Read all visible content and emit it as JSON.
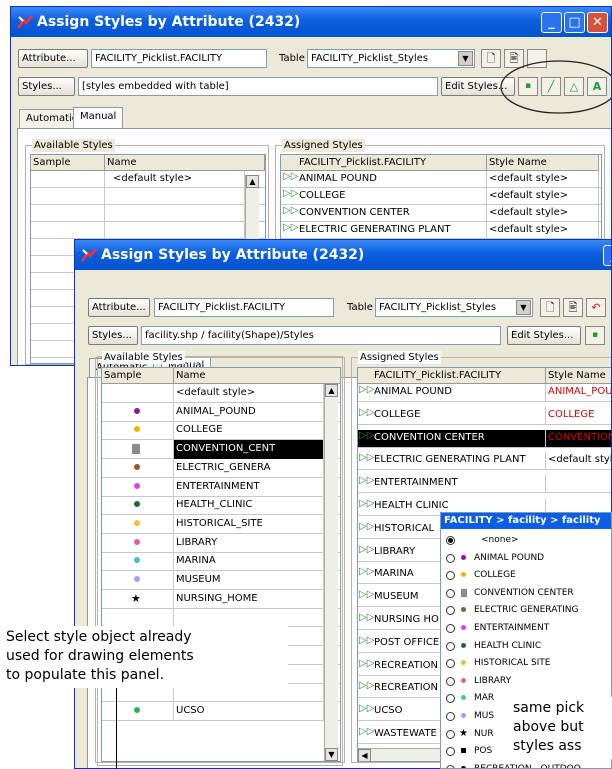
{
  "back_window": {
    "title": "Assign Styles by Attribute (2432)",
    "attribute_button": "Attribute...",
    "attribute_value": "FACILITY_Picklist.FACILITY",
    "table_label": "Table",
    "table_value": "FACILITY_Picklist_Styles",
    "styles_button": "Styles...",
    "styles_value": "[styles embedded with table]",
    "edit_styles_button": "Edit Styles...",
    "tabs": [
      "Automatic",
      "Manual"
    ],
    "available_legend": "Available Styles",
    "available_headers": [
      "Sample",
      "Name"
    ],
    "available_rows": [
      "<default style>"
    ],
    "assigned_legend": "Assigned Styles",
    "assigned_headers": [
      "FACILITY_Picklist.FACILITY",
      "Style Name"
    ],
    "assigned_rows": [
      {
        "facility": "ANIMAL POUND",
        "style": "<default style>"
      },
      {
        "facility": "COLLEGE",
        "style": "<default style>"
      },
      {
        "facility": "CONVENTION CENTER",
        "style": "<default style>"
      },
      {
        "facility": "ELECTRIC GENERATING PLANT",
        "style": "<default style>"
      }
    ]
  },
  "front_window": {
    "title": "Assign Styles by Attribute (2432)",
    "attribute_button": "Attribute...",
    "attribute_value": "FACILITY_Picklist.FACILITY",
    "table_label": "Table",
    "table_value": "FACILITY_Picklist_Styles",
    "styles_button": "Styles...",
    "styles_value": "facility.shp / facility(Shape)/Styles",
    "edit_styles_button": "Edit Styles...",
    "tabs": [
      "Automatic",
      "Manual"
    ],
    "available_legend": "Available Styles",
    "available_headers": [
      "Sample",
      "Name"
    ],
    "available_rows": [
      {
        "name": "<default style>",
        "color": ""
      },
      {
        "name": "ANIMAL_POUND",
        "color": "#8b1a9b"
      },
      {
        "name": "COLLEGE",
        "color": "#f2b500"
      },
      {
        "name": "CONVENTION_CENT",
        "color": "#8a8a8a"
      },
      {
        "name": "ELECTRIC_GENERA",
        "color": "#8b5a2b"
      },
      {
        "name": "ENTERTAINMENT",
        "color": "#e040e0"
      },
      {
        "name": "HEALTH_CLINIC",
        "color": "#1a6b2a"
      },
      {
        "name": "HISTORICAL_SITE",
        "color": "#f0c030"
      },
      {
        "name": "LIBRARY",
        "color": "#e060a0"
      },
      {
        "name": "MARINA",
        "color": "#40c0d0"
      },
      {
        "name": "MUSEUM",
        "color": "#a0a0ff"
      },
      {
        "name": "NURSING_HOME",
        "color": "#000000"
      },
      {
        "name": "",
        "color": ""
      },
      {
        "name": "",
        "color": ""
      },
      {
        "name": "",
        "color": ""
      },
      {
        "name": "",
        "color": ""
      },
      {
        "name": "",
        "color": ""
      },
      {
        "name": "UCSO",
        "color": "#30b050"
      }
    ],
    "selected_available_index": 3,
    "assigned_legend": "Assigned Styles",
    "assigned_headers": [
      "FACILITY_Picklist.FACILITY",
      "Style Name"
    ],
    "assigned_rows": [
      {
        "facility": "ANIMAL POUND",
        "style": "ANIMAL_POU",
        "style_color": "#e00000"
      },
      {
        "facility": "COLLEGE",
        "style": "COLLEGE",
        "style_color": "#e00000"
      },
      {
        "facility": "CONVENTION CENTER",
        "style": "CONVENTION",
        "style_color": "#e00000"
      },
      {
        "facility": "ELECTRIC GENERATING PLANT",
        "style": "<default styl",
        "style_color": "#000000"
      },
      {
        "facility": "ENTERTAINMENT",
        "style": "",
        "style_color": "#000000"
      },
      {
        "facility": "HEALTH CLINIC",
        "style": "",
        "style_color": "#000000"
      },
      {
        "facility": "HISTORICAL",
        "style": "",
        "style_color": "#000000"
      },
      {
        "facility": "LIBRARY",
        "style": "",
        "style_color": "#000000"
      },
      {
        "facility": "MARINA",
        "style": "",
        "style_color": "#000000"
      },
      {
        "facility": "MUSEUM",
        "style": "",
        "style_color": "#000000"
      },
      {
        "facility": "NURSING HO",
        "style": "",
        "style_color": "#000000"
      },
      {
        "facility": "POST OFFICE",
        "style": "",
        "style_color": "#000000"
      },
      {
        "facility": "RECREATION",
        "style": "",
        "style_color": "#000000"
      },
      {
        "facility": "RECREATION",
        "style": "",
        "style_color": "#000000"
      },
      {
        "facility": "UCSO",
        "style": "",
        "style_color": "#000000"
      },
      {
        "facility": "WASTEWATE",
        "style": "",
        "style_color": "#000000"
      }
    ],
    "selected_assigned_index": 2
  },
  "picklist": {
    "title": "FACILITY > facility > facility",
    "items": [
      {
        "label": "<none>",
        "color": "",
        "selected": true
      },
      {
        "label": "ANIMAL POUND",
        "color": "#8b1a9b",
        "selected": false
      },
      {
        "label": "COLLEGE",
        "color": "#f2b500",
        "selected": false
      },
      {
        "label": "CONVENTION CENTER",
        "color": "#8a8a8a",
        "selected": false
      },
      {
        "label": "ELECTRIC GENERATING",
        "color": "#8b5a2b",
        "selected": false
      },
      {
        "label": "ENTERTAINMENT",
        "color": "#e040e0",
        "selected": false
      },
      {
        "label": "HEALTH CLINIC",
        "color": "#1a6b2a",
        "selected": false
      },
      {
        "label": "HISTORICAL SITE",
        "color": "#f0c030",
        "selected": false
      },
      {
        "label": "LIBRARY",
        "color": "#e060a0",
        "selected": false
      },
      {
        "label": "MAR",
        "color": "#40c0d0",
        "selected": false
      },
      {
        "label": "MUS",
        "color": "#a0a0ff",
        "selected": false
      },
      {
        "label": "NUR",
        "color": "#000000",
        "selected": false
      },
      {
        "label": "POS",
        "color": "#000000",
        "selected": false
      },
      {
        "label": "RECREATION - OUTDOO",
        "color": "#000000",
        "selected": false
      }
    ]
  },
  "annotations": {
    "left_note_lines": [
      "Select style object already",
      "used for drawing elements",
      "to populate this panel."
    ],
    "right_note_lines": [
      "same pick",
      "above but",
      "styles ass"
    ]
  }
}
